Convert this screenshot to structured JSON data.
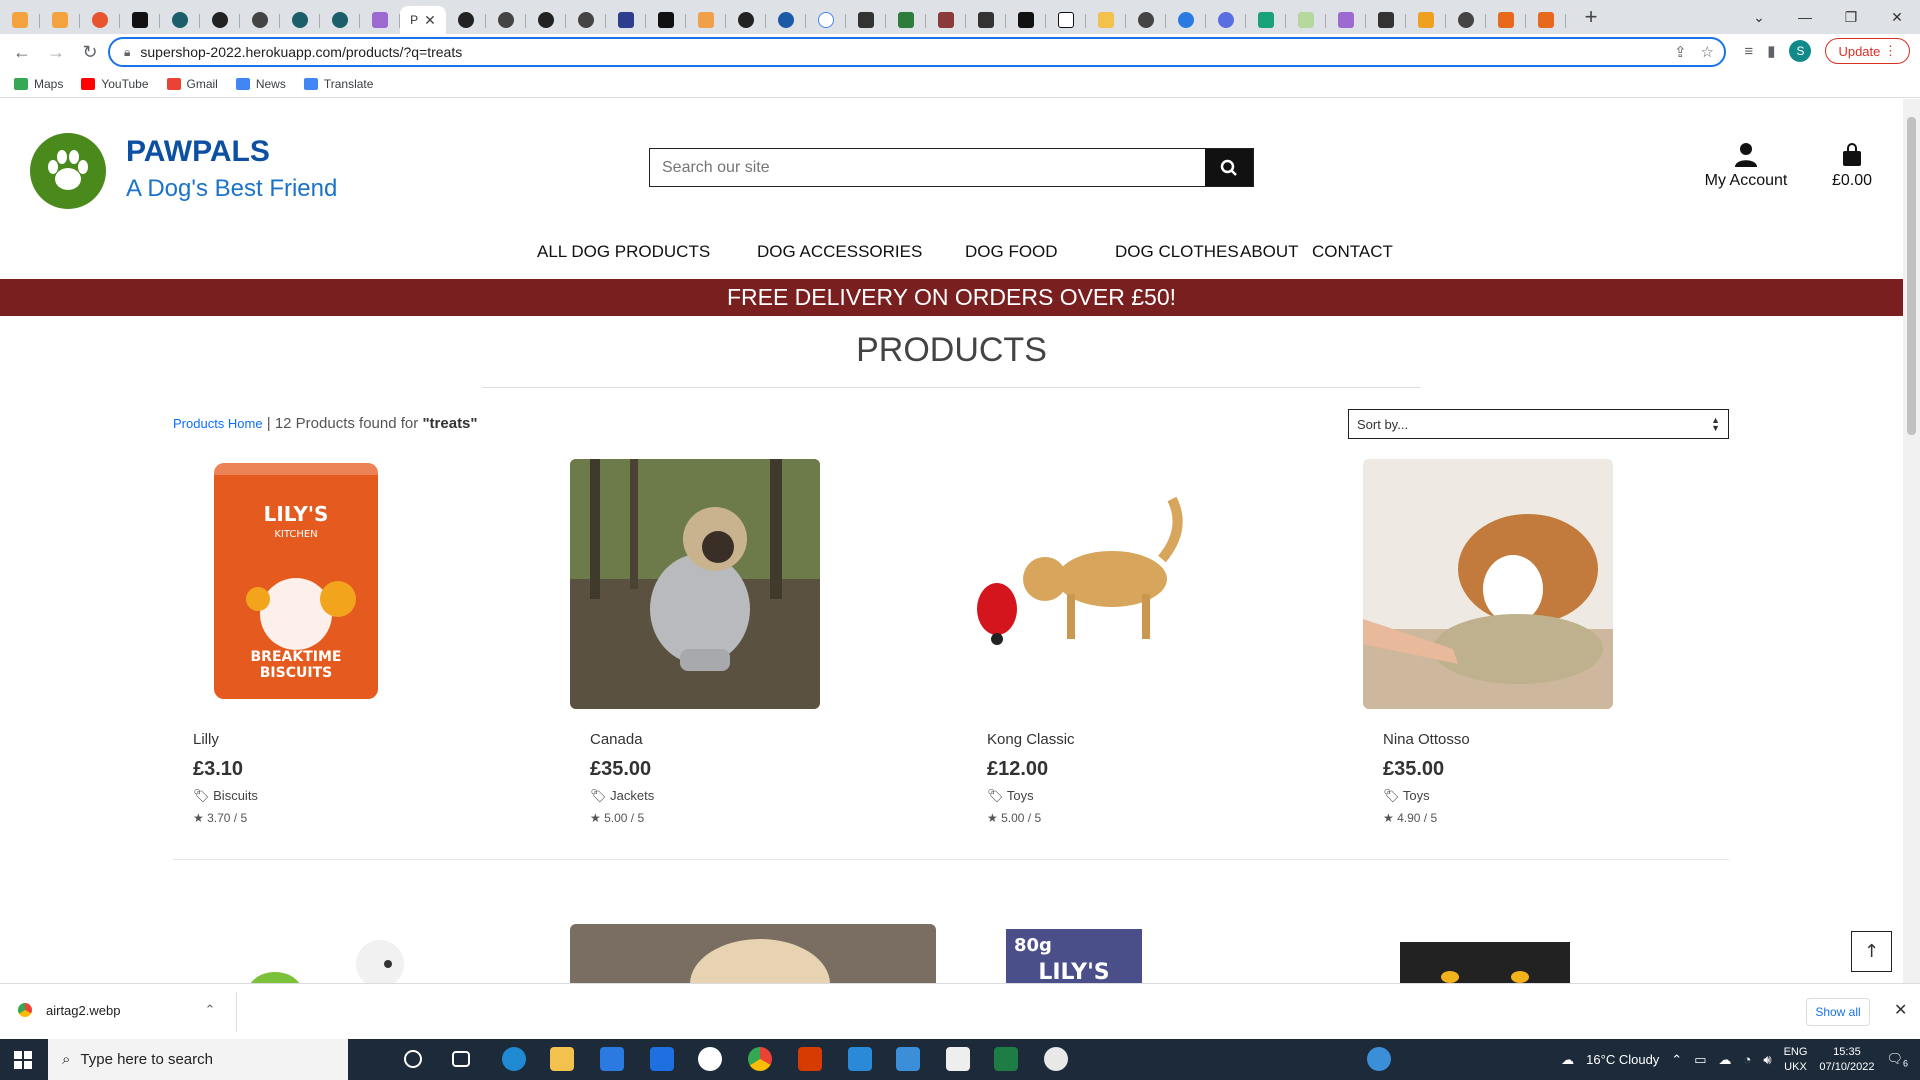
{
  "browser": {
    "active_tab_title": "P",
    "url": "supershop-2022.herokuapp.com/products/?q=treats",
    "update_label": "Update",
    "profile_initial": "S",
    "bookmarks": [
      "Maps",
      "YouTube",
      "Gmail",
      "News",
      "Translate"
    ]
  },
  "site": {
    "brand_title": "PAWPALS",
    "brand_subtitle": "A Dog's Best Friend",
    "search_placeholder": "Search our site",
    "account_label": "My Account",
    "cart_total": "£0.00",
    "nav": [
      "ALL DOG PRODUCTS",
      "DOG ACCESSORIES",
      "DOG FOOD",
      "DOG CLOTHES",
      "ABOUT",
      "CONTACT"
    ],
    "banner": "FREE DELIVERY ON ORDERS OVER £50!",
    "page_title": "PRODUCTS",
    "breadcrumb_link": "Products Home",
    "results_text": "| 12 Products found for",
    "search_term": "\"treats\"",
    "sort_label": "Sort by...",
    "products": [
      {
        "name": "Lilly",
        "price": "£3.10",
        "category": "Biscuits",
        "rating": "3.70 / 5"
      },
      {
        "name": "Canada",
        "price": "£35.00",
        "category": "Jackets",
        "rating": "5.00 / 5"
      },
      {
        "name": "Kong Classic",
        "price": "£12.00",
        "category": "Toys",
        "rating": "5.00 / 5"
      },
      {
        "name": "Nina Ottosso",
        "price": "£35.00",
        "category": "Toys",
        "rating": "4.90 / 5"
      }
    ],
    "product_image_text": {
      "lilly_brand": "LILY'S",
      "lilly_sub": "KITCHEN",
      "lilly_line": "BREAKTIME",
      "lilly_line2": "BISCUITS",
      "row2_weight": "80g",
      "row2_brand": "LILY'S"
    }
  },
  "downloads": {
    "file_name": "airtag2.webp",
    "show_all": "Show all"
  },
  "taskbar": {
    "search_placeholder": "Type here to search",
    "weather": "16°C  Cloudy",
    "lang": "ENG",
    "lang2": "UKX",
    "time": "15:35",
    "date": "07/10/2022",
    "notif_count": "6"
  },
  "colors": {
    "brand_blue": "#0d4fa3",
    "banner_red": "#7a1f1f",
    "logo_green": "#4a8a1d"
  }
}
